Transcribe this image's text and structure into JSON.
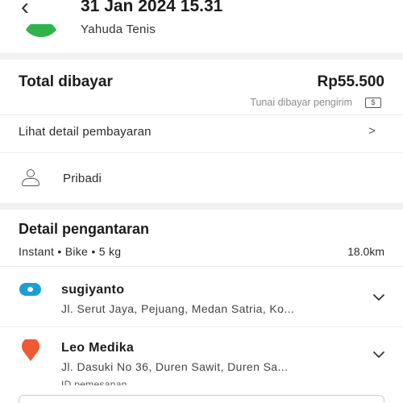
{
  "header": {
    "back_icon": "chevron-left-icon",
    "title": "31 Jan 2024 15.31"
  },
  "driver": {
    "vehicle_name": "Yahuda Tenis",
    "avatar_colors": {
      "shirt": "#2fb34a",
      "head": "#2a2a2a"
    }
  },
  "payment": {
    "total_label": "Total dibayar",
    "total_amount": "Rp55.500",
    "method_note": "Tunai dibayar pengirim",
    "method_icon": "cash-icon",
    "method_icon_glyph": "$",
    "detail_link": "Lihat detail pembayaran",
    "detail_chevron": ">"
  },
  "profile": {
    "icon": "person-icon",
    "label": "Pribadi"
  },
  "delivery": {
    "title": "Detail pengantaran",
    "meta": "Instant • Bike • 5 kg",
    "distance": "18.0km",
    "stops": [
      {
        "icon": "origin-pin-icon",
        "color": "#1a9fd5",
        "name": "sugiyanto",
        "address": "Jl. Serut Jaya, Pejuang, Medan Satria, Ko..."
      },
      {
        "icon": "destination-pin-icon",
        "color": "#ee5a33",
        "name": "Leo Medika",
        "address": "Jl. Dasuki No 36, Duren Sawit, Duren Sa...",
        "extra": "ID pemesanan"
      }
    ]
  }
}
